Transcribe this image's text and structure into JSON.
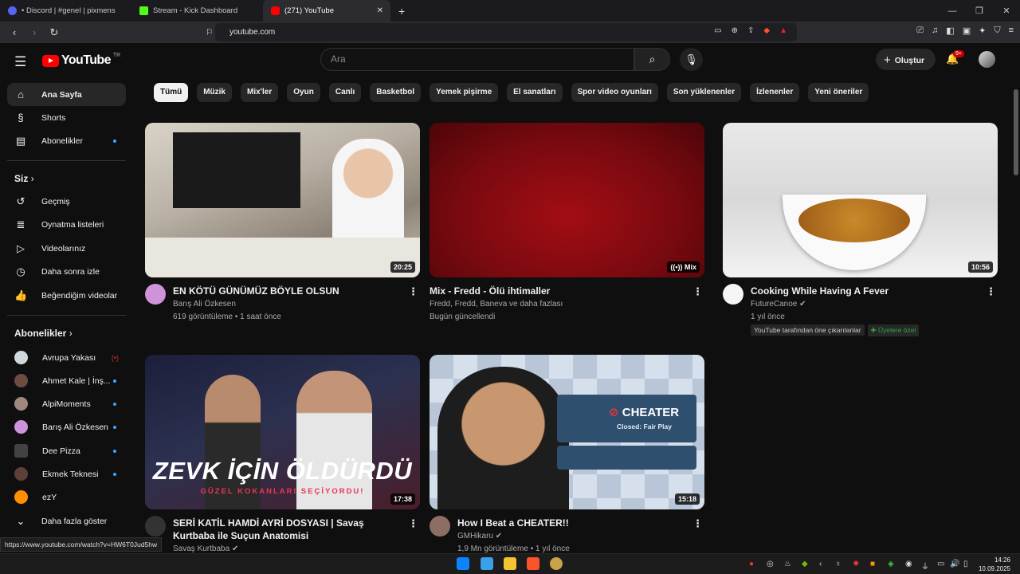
{
  "browser": {
    "tabs": [
      {
        "label": "• Discord | #genel | pixmens",
        "color": "#5865f2"
      },
      {
        "label": "Stream - Kick Dashboard",
        "color": "#53fc18"
      },
      {
        "label": "(271) YouTube",
        "color": "#ff0000"
      }
    ],
    "url": "youtube.com"
  },
  "masthead": {
    "logo_text": "YouTube",
    "region": "TR",
    "search_placeholder": "Ara",
    "create_label": "Oluştur",
    "notif_badge": "9+"
  },
  "sidebar": {
    "main": [
      {
        "label": "Ana Sayfa",
        "icon": "home-icon"
      },
      {
        "label": "Shorts",
        "icon": "shorts-icon"
      },
      {
        "label": "Abonelikler",
        "icon": "subscriptions-icon"
      }
    ],
    "you_header": "Siz",
    "you": [
      {
        "label": "Geçmiş",
        "icon": "history-icon"
      },
      {
        "label": "Oynatma listeleri",
        "icon": "playlists-icon"
      },
      {
        "label": "Videolarınız",
        "icon": "your-videos-icon"
      },
      {
        "label": "Daha sonra izle",
        "icon": "watch-later-icon"
      },
      {
        "label": "Beğendiğim videolar",
        "icon": "liked-icon"
      }
    ],
    "subs_header": "Abonelikler",
    "subs": [
      {
        "label": "Avrupa Yakası",
        "color": "#cfd8dc"
      },
      {
        "label": "Ahmet Kale | İnş...",
        "color": "#6d4c41"
      },
      {
        "label": "AlpiMoments",
        "color": "#a1887f"
      },
      {
        "label": "Barış Ali Özkesen",
        "color": "#ce93d8"
      },
      {
        "label": "Dee Pizza",
        "color": "#424242"
      },
      {
        "label": "Ekmek Teknesi",
        "color": "#5d4037"
      },
      {
        "label": "ezY",
        "color": "#ff8f00"
      }
    ],
    "show_more": "Daha fazla göster"
  },
  "chips": [
    "Tümü",
    "Müzik",
    "Mix'ler",
    "Oyun",
    "Canlı",
    "Basketbol",
    "Yemek pişirme",
    "El sanatları",
    "Spor video oyunları",
    "Son yüklenenler",
    "İzlenenler",
    "Yeni öneriler"
  ],
  "videos": [
    {
      "title": "EN KÖTÜ GÜNÜMÜZ BÖYLE OLSUN",
      "channel": "Barış Ali Özkesen",
      "stats": "619 görüntüleme • 1 saat önce",
      "duration": "20:25"
    },
    {
      "title": "Mix - Fredd - Ölü ihtimaller",
      "channel": "Fredd, Fredd, Baneva ve daha fazlası",
      "stats": "Bugün güncellendi",
      "duration": "Mix"
    },
    {
      "title": "Cooking While Having A Fever",
      "channel": "FutureCanoe",
      "stats": "1 yıl önce",
      "duration": "10:56",
      "tags": [
        "YouTube tarafından öne çıkarılanlar",
        "Üyelere özel"
      ]
    },
    {
      "title": "SERİ KATİL HAMDİ AYRİ DOSYASI | Savaş Kurtbaba ile Suçun Anatomisi",
      "channel": "Savaş Kurtbaba",
      "stats": "",
      "duration": "17:38",
      "thumb_text": "ZEVK İÇİN ÖLDÜRDÜ",
      "thumb_sub": "GÜZEL KOKANLARI SEÇİYORDU!"
    },
    {
      "title": "How I Beat a CHEATER!!",
      "channel": "GMHikaru",
      "stats": "1,9 Mn görüntüleme • 1 yıl önce",
      "duration": "15:18",
      "thumb_text": "CHEATER",
      "thumb_sub": "Closed: Fair Play"
    }
  ],
  "status_url": "https://www.youtube.com/watch?v=HW6T0Jud5hw",
  "clock": {
    "time": "14:26",
    "date": "10.09.2025"
  }
}
